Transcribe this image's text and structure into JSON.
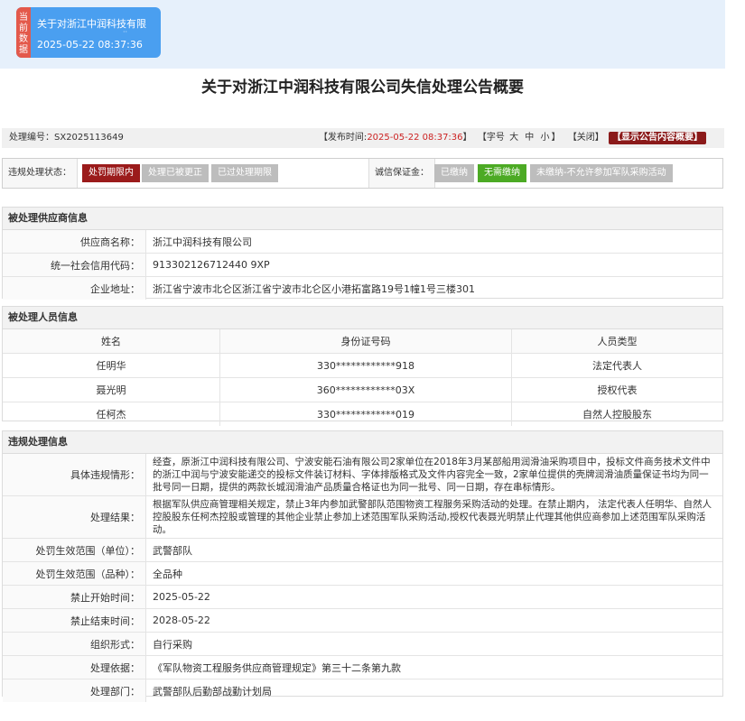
{
  "now_card": {
    "tag": "当前数据",
    "company": "关于对浙江中润科技有限",
    "time": "2025-05-22 08:37:36",
    "dots": "··"
  },
  "title": "关于对浙江中润科技有限公司失信处理公告概要",
  "meta": {
    "number": "处理编号：SX2025113649",
    "publish_prefix": "【发布时间:",
    "publish_time": "2025-05-22 08:37:36",
    "publish_suffix": "】",
    "font_prefix": "【字号",
    "font_large": "大",
    "font_mid": "中",
    "font_small": "小",
    "font_suffix": "】",
    "close": "【关闭】",
    "show_content": "【显示公告内容概要】"
  },
  "status": {
    "label": "违规处理状态：",
    "chips": [
      "处罚期限内",
      "处理已被更正",
      "已过处理期限"
    ],
    "deposit_label": "诚信保证金：",
    "deposit_chips": [
      "已缴纳",
      "无需缴纳",
      "未缴纳-不允许参加军队采购活动"
    ],
    "colors": {
      "active": "#9b1b1b",
      "inactive": "#bdbdbd",
      "ok": "#4caa24"
    }
  },
  "supplier": {
    "heading": "被处理供应商信息",
    "rows": [
      {
        "k": "供应商名称：",
        "v": "浙江中润科技有限公司"
      },
      {
        "k": "统一社会信用代码：",
        "v": "913302126712440 9XP"
      },
      {
        "k": "企业地址：",
        "v": "浙江省宁波市北仑区浙江省宁波市北仑区小港拓富路19号1幢1号三楼301"
      }
    ]
  },
  "persons": {
    "heading": "被处理人员信息",
    "columns": [
      "姓名",
      "身份证号码",
      "人员类型"
    ],
    "rows": [
      [
        "任明华",
        "330************918",
        "法定代表人"
      ],
      [
        "聂光明",
        "360************03X",
        "授权代表"
      ],
      [
        "任柯杰",
        "330************019",
        "自然人控股股东"
      ]
    ]
  },
  "violation": {
    "heading": "违规处理信息",
    "detail_k": "具体违规情形：",
    "detail_v": "经查，原浙江中润科技有限公司、宁波安能石油有限公司2家单位在2018年3月某部船用润滑油采购项目中，投标文件商务技术文件中的浙江中润与宁波安能递交的投标文件装订材料、字体排版格式及文件内容完全一致，2家单位提供的壳牌润滑油质量保证书均为同一批号同一日期，提供的两款长城润滑油产品质量合格证也为同一批号、同一日期，存在串标情形。",
    "result_k": "处理结果：",
    "result_v": "根据军队供应商管理相关规定，禁止3年内参加武警部队范围物资工程服务采购活动的处理。在禁止期内， 法定代表人任明华、自然人控股股东任柯杰控股或管理的其他企业禁止参加上述范围军队采购活动,授权代表聂光明禁止代理其他供应商参加上述范围军队采购活动。",
    "rows": [
      {
        "k": "处罚生效范围（单位）：",
        "v": "武警部队"
      },
      {
        "k": "处罚生效范围（品种）：",
        "v": "全品种"
      },
      {
        "k": "禁止开始时间：",
        "v": "2025-05-22"
      },
      {
        "k": "禁止结束时间：",
        "v": "2028-05-22"
      },
      {
        "k": "组织形式：",
        "v": "自行采购"
      },
      {
        "k": "处理依据：",
        "v": "《军队物资工程服务供应商管理规定》第三十二条第九款"
      },
      {
        "k": "处理部门：",
        "v": "武警部队后勤部战勤计划局"
      }
    ]
  }
}
